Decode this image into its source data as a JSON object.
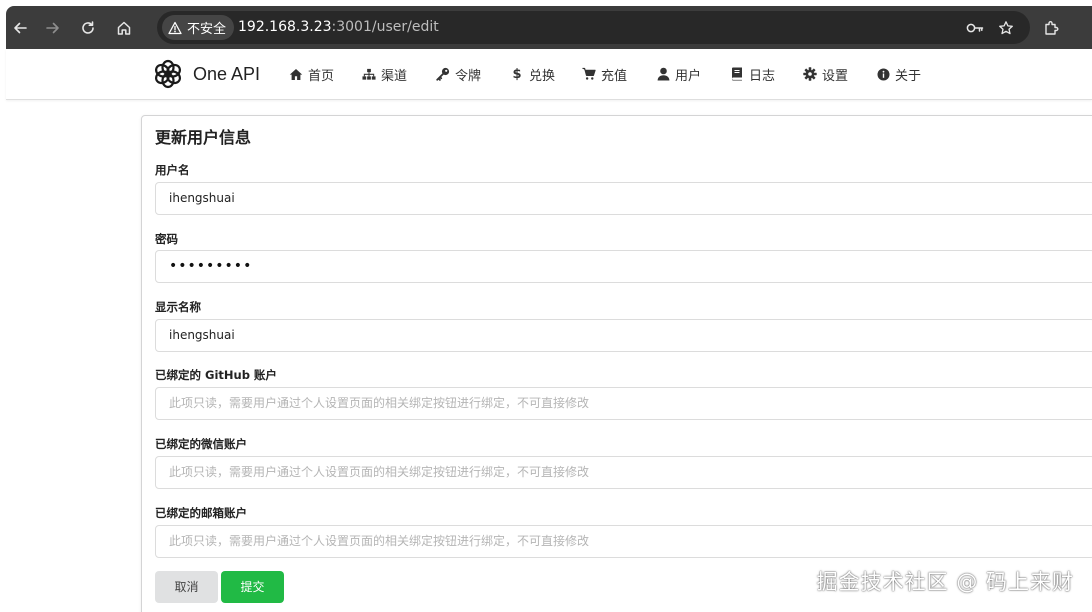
{
  "browser": {
    "security_label": "不安全",
    "url_host": "192.168.3.23",
    "url_path": ":3001/user/edit",
    "icons": {
      "back": "arrow-left-icon",
      "forward": "arrow-right-icon",
      "reload": "reload-icon",
      "home": "home-icon",
      "warning": "warning-icon",
      "password": "key-icon",
      "bookmark": "star-icon",
      "extensions": "puzzle-icon"
    }
  },
  "header": {
    "brand": "One API",
    "menu": [
      {
        "label": "首页",
        "icon": "home-icon"
      },
      {
        "label": "渠道",
        "icon": "sitemap-icon"
      },
      {
        "label": "令牌",
        "icon": "key-icon"
      },
      {
        "label": "兑换",
        "icon": "dollar-icon"
      },
      {
        "label": "充值",
        "icon": "cart-icon"
      },
      {
        "label": "用户",
        "icon": "user-icon"
      },
      {
        "label": "日志",
        "icon": "book-icon"
      },
      {
        "label": "设置",
        "icon": "gear-icon"
      },
      {
        "label": "关于",
        "icon": "info-icon"
      }
    ]
  },
  "form": {
    "title": "更新用户信息",
    "username": {
      "label": "用户名",
      "value": "ihengshuai"
    },
    "password": {
      "label": "密码",
      "value": "•••••••••"
    },
    "display_name": {
      "label": "显示名称",
      "value": "ihengshuai"
    },
    "github": {
      "label": "已绑定的 GitHub 账户",
      "placeholder": "此项只读，需要用户通过个人设置页面的相关绑定按钮进行绑定，不可直接修改"
    },
    "wechat": {
      "label": "已绑定的微信账户",
      "placeholder": "此项只读，需要用户通过个人设置页面的相关绑定按钮进行绑定，不可直接修改"
    },
    "email": {
      "label": "已绑定的邮箱账户",
      "placeholder": "此项只读，需要用户通过个人设置页面的相关绑定按钮进行绑定，不可直接修改"
    },
    "cancel_label": "取消",
    "submit_label": "提交"
  },
  "watermark": "掘金技术社区 @ 码上来财",
  "colors": {
    "browser_bar": "#3c3c3c",
    "omnibox": "#282828",
    "submit": "#21ba45",
    "cancel": "#e0e1e2"
  }
}
